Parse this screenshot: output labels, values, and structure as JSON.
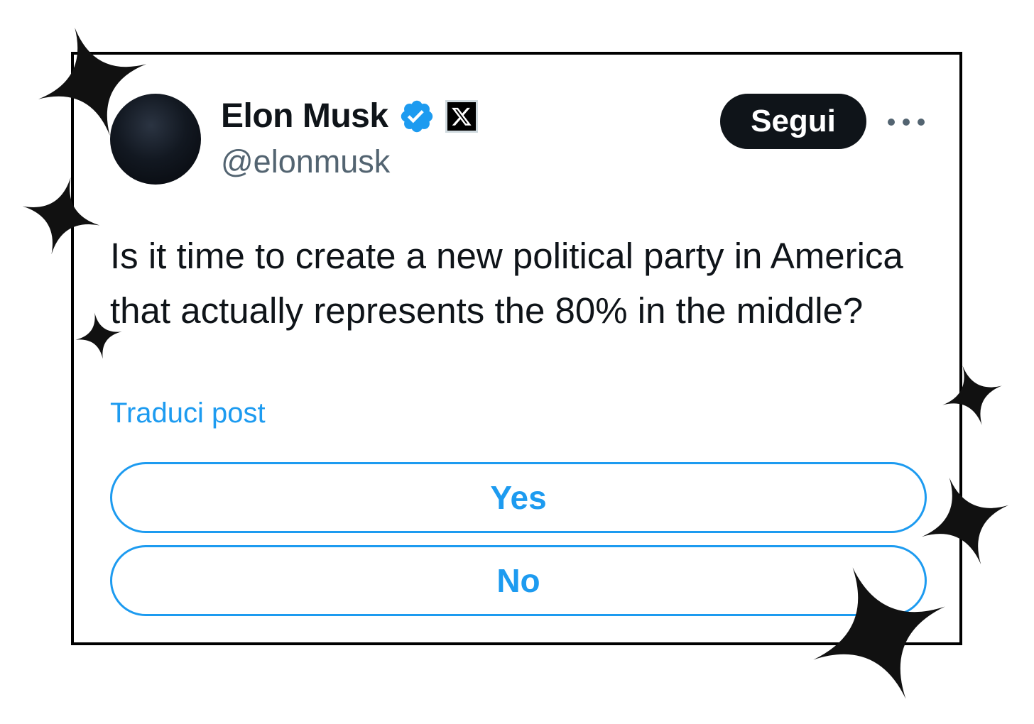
{
  "author": {
    "name": "Elon Musk",
    "handle": "@elonmusk",
    "verified": true,
    "affiliation_icon": "x-logo-icon"
  },
  "header": {
    "follow_label": "Segui",
    "more_icon": "more-horizontal-icon"
  },
  "post": {
    "text": "Is it time to create a new political party in America that actually represents the 80% in the middle?",
    "translate_label": "Traduci post"
  },
  "poll": {
    "options": [
      {
        "label": "Yes"
      },
      {
        "label": "No"
      }
    ]
  },
  "colors": {
    "accent": "#1d9bf0",
    "text_primary": "#0f1419",
    "text_secondary": "#536471",
    "frame": "#000000"
  },
  "decorations": {
    "sparkle_icon": "four-point-star-icon",
    "sparkle_count": 7
  }
}
